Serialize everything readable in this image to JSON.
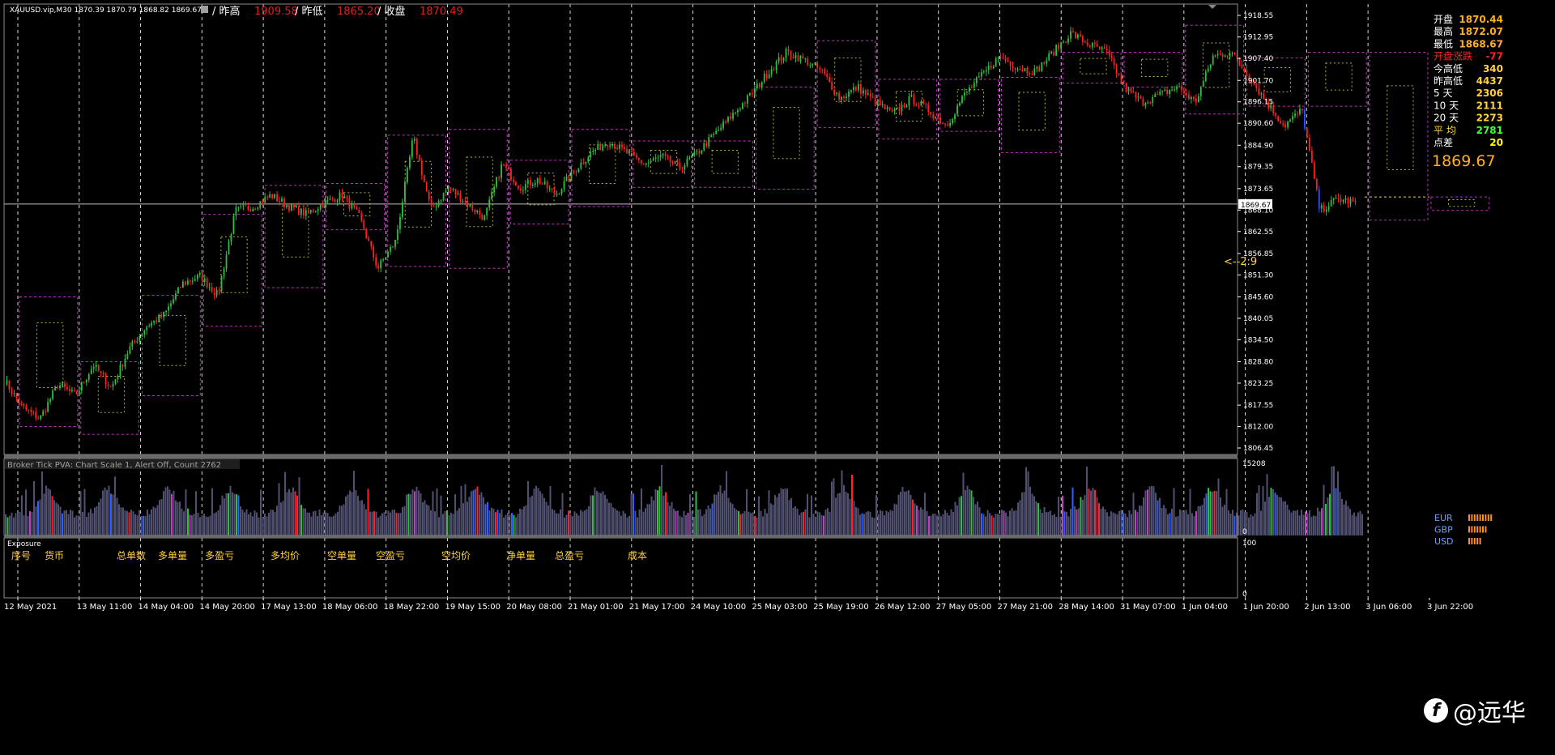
{
  "header": {
    "symbol_line": "XAUUSD.vip,M30  1870.39 1870.79 1868.82 1869.67",
    "prev_high_label": "/ 昨高",
    "prev_high_value": "1909.58",
    "prev_low_label": "/ 昨低",
    "prev_low_value": "1865.20",
    "close_label": "/ 收盘",
    "close_value": "1870.49"
  },
  "info_panel": [
    {
      "label": "开盘",
      "value": "1870.44",
      "label_color": "#ffffff",
      "value_color": "#ffb020"
    },
    {
      "label": "最高",
      "value": "1872.07",
      "label_color": "#ffffff",
      "value_color": "#ffb020"
    },
    {
      "label": "最低",
      "value": "1868.67",
      "label_color": "#ffffff",
      "value_color": "#ffb020"
    },
    {
      "label": "开盘涨跌",
      "value": "-77",
      "label_color": "#ff2020",
      "value_color": "#ff2020"
    },
    {
      "label": "今高低",
      "value": "340",
      "label_color": "#ffffff",
      "value_color": "#ffd040"
    },
    {
      "label": "昨高低",
      "value": "4437",
      "label_color": "#ffffff",
      "value_color": "#ffd040"
    },
    {
      "label": "5   天",
      "value": "2306",
      "label_color": "#ffffff",
      "value_color": "#ffd040"
    },
    {
      "label": "10  天",
      "value": "2111",
      "label_color": "#ffffff",
      "value_color": "#ffd040"
    },
    {
      "label": "20  天",
      "value": "2273",
      "label_color": "#ffffff",
      "value_color": "#ffd040"
    },
    {
      "label": "平  均",
      "value": "2781",
      "label_color": "#ffd040",
      "value_color": "#40ff40"
    },
    {
      "label": "点差",
      "value": "20",
      "label_color": "#ffffff",
      "value_color": "#ffff00"
    }
  ],
  "big_price": "1869.67",
  "currencies": [
    "EUR",
    "GBP",
    "USD"
  ],
  "bid_tag": "1869.67",
  "ratio_label": "<--2:9",
  "indicator_line": "Broker Tick PVA:   Chart Scale  1,  Alert Off,  Count   2762",
  "indicator_axis": [
    "15208",
    "0"
  ],
  "exposure": {
    "title": "Exposure",
    "headers": [
      "序号",
      "货币",
      "总单数",
      "多单量",
      "多盈亏",
      "多均价",
      "空单量",
      "空盈亏",
      "空均价",
      "净单量",
      "总盈亏",
      "成本"
    ],
    "axis": [
      "100",
      "0"
    ]
  },
  "watermark": "@远华",
  "watermark_logo": "f",
  "chart_data": {
    "type": "candlestick",
    "title": "",
    "xlabel": "",
    "ylabel": "",
    "ylim": [
      1806.45,
      1918.55
    ],
    "y_ticks": [
      "1918.55",
      "1912.95",
      "1907.40",
      "1901.70",
      "1896.15",
      "1890.60",
      "1884.90",
      "1879.35",
      "1873.65",
      "1868.10",
      "1862.55",
      "1856.85",
      "1851.30",
      "1845.60",
      "1840.05",
      "1834.50",
      "1828.80",
      "1823.25",
      "1817.55",
      "1812.00",
      "1806.45"
    ],
    "x_ticks": [
      "12 May 2021",
      "13 May 11:00",
      "14 May 04:00",
      "14 May 20:00",
      "17 May 13:00",
      "18 May 06:00",
      "18 May 22:00",
      "19 May 15:00",
      "20 May 08:00",
      "21 May 01:00",
      "21 May 17:00",
      "24 May 10:00",
      "25 May 03:00",
      "25 May 19:00",
      "26 May 12:00",
      "27 May 05:00",
      "27 May 21:00",
      "28 May 14:00",
      "31 May 07:00",
      "1 Jun 04:00",
      "1 Jun 20:00",
      "2 Jun 13:00",
      "3 Jun 06:00",
      "3 Jun 22:00"
    ],
    "price_path": [
      1824,
      1817,
      1814,
      1823,
      1820,
      1828,
      1822,
      1832,
      1838,
      1841,
      1849,
      1851,
      1846,
      1868,
      1869,
      1872,
      1869,
      1867,
      1870,
      1872,
      1866,
      1853,
      1860,
      1887,
      1868,
      1874,
      1870,
      1866,
      1880,
      1874,
      1876,
      1872,
      1878,
      1883,
      1886,
      1883,
      1880,
      1882,
      1879,
      1883,
      1888,
      1893,
      1898,
      1904,
      1909,
      1907,
      1904,
      1897,
      1900,
      1896,
      1893,
      1897,
      1894,
      1890,
      1898,
      1903,
      1908,
      1905,
      1904,
      1909,
      1914,
      1911,
      1909,
      1900,
      1896,
      1898,
      1900,
      1896,
      1908,
      1909,
      1903,
      1896,
      1890,
      1894,
      1868,
      1871,
      1870
    ],
    "current_price": 1869.67,
    "ratio_line_price": 1871.5,
    "range_boxes": [
      {
        "from": 0,
        "to": 1,
        "high": 1845.6,
        "low": 1812.0
      },
      {
        "from": 1,
        "to": 2,
        "high": 1828.8,
        "low": 1810.0
      },
      {
        "from": 2,
        "to": 3,
        "high": 1846.0,
        "low": 1820.0
      },
      {
        "from": 3,
        "to": 4,
        "high": 1867.0,
        "low": 1838.0
      },
      {
        "from": 4,
        "to": 5,
        "high": 1874.5,
        "low": 1848.0
      },
      {
        "from": 5,
        "to": 6,
        "high": 1875.0,
        "low": 1863.0
      },
      {
        "from": 6,
        "to": 7,
        "high": 1887.5,
        "low": 1853.5
      },
      {
        "from": 7,
        "to": 8,
        "high": 1889.0,
        "low": 1853.0
      },
      {
        "from": 8,
        "to": 9,
        "high": 1881.0,
        "low": 1864.5
      },
      {
        "from": 9,
        "to": 10,
        "high": 1889.0,
        "low": 1869.0
      },
      {
        "from": 10,
        "to": 11,
        "high": 1886.0,
        "low": 1874.0
      },
      {
        "from": 11,
        "to": 12,
        "high": 1886.0,
        "low": 1874.0
      },
      {
        "from": 12,
        "to": 13,
        "high": 1900.0,
        "low": 1873.5
      },
      {
        "from": 13,
        "to": 14,
        "high": 1912.0,
        "low": 1889.5
      },
      {
        "from": 14,
        "to": 15,
        "high": 1902.0,
        "low": 1886.5
      },
      {
        "from": 15,
        "to": 16,
        "high": 1902.0,
        "low": 1888.5
      },
      {
        "from": 16,
        "to": 17,
        "high": 1902.5,
        "low": 1883.0
      },
      {
        "from": 17,
        "to": 18,
        "high": 1909.0,
        "low": 1901.0
      },
      {
        "from": 18,
        "to": 19,
        "high": 1909.0,
        "low": 1900.0
      },
      {
        "from": 19,
        "to": 20,
        "high": 1916.0,
        "low": 1893.0
      },
      {
        "from": 20,
        "to": 21,
        "high": 1907.5,
        "low": 1895.0
      },
      {
        "from": 21,
        "to": 22,
        "high": 1909.0,
        "low": 1895.0
      },
      {
        "from": 22,
        "to": 23,
        "high": 1909.0,
        "low": 1865.5
      },
      {
        "from": 23,
        "to": 24,
        "high": 1871.5,
        "low": 1868.0
      }
    ],
    "indicator_ylim": [
      0,
      15208
    ],
    "indicator_colors": [
      "#505070",
      "#ff2030",
      "#30c040",
      "#3060ff",
      "#c040c0"
    ],
    "colors": {
      "bull": "#30c040",
      "bear": "#ff2020",
      "spike": "#3050ff",
      "box": "#c030c0",
      "inner_box": "#e0e050",
      "grid": "#ffffff",
      "axis_text": "#ffffff",
      "ratio": "#ffd040"
    }
  }
}
